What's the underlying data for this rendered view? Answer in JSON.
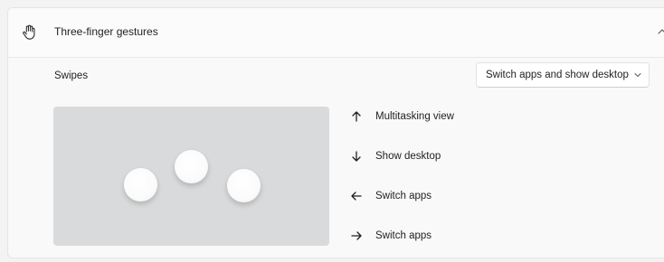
{
  "section": {
    "title": "Three-finger gestures",
    "icon": "hand-icon",
    "expanded": true
  },
  "swipes": {
    "label": "Swipes",
    "selected": "Switch apps and show desktop"
  },
  "gestures": [
    {
      "direction": "up",
      "icon": "arrow-up-icon",
      "label": "Multitasking view"
    },
    {
      "direction": "down",
      "icon": "arrow-down-icon",
      "label": "Show desktop"
    },
    {
      "direction": "left",
      "icon": "arrow-left-icon",
      "label": "Switch apps"
    },
    {
      "direction": "right",
      "icon": "arrow-right-icon",
      "label": "Switch apps"
    }
  ],
  "colors": {
    "preview_background": "#d9dadb",
    "finger": "#ffffff"
  }
}
